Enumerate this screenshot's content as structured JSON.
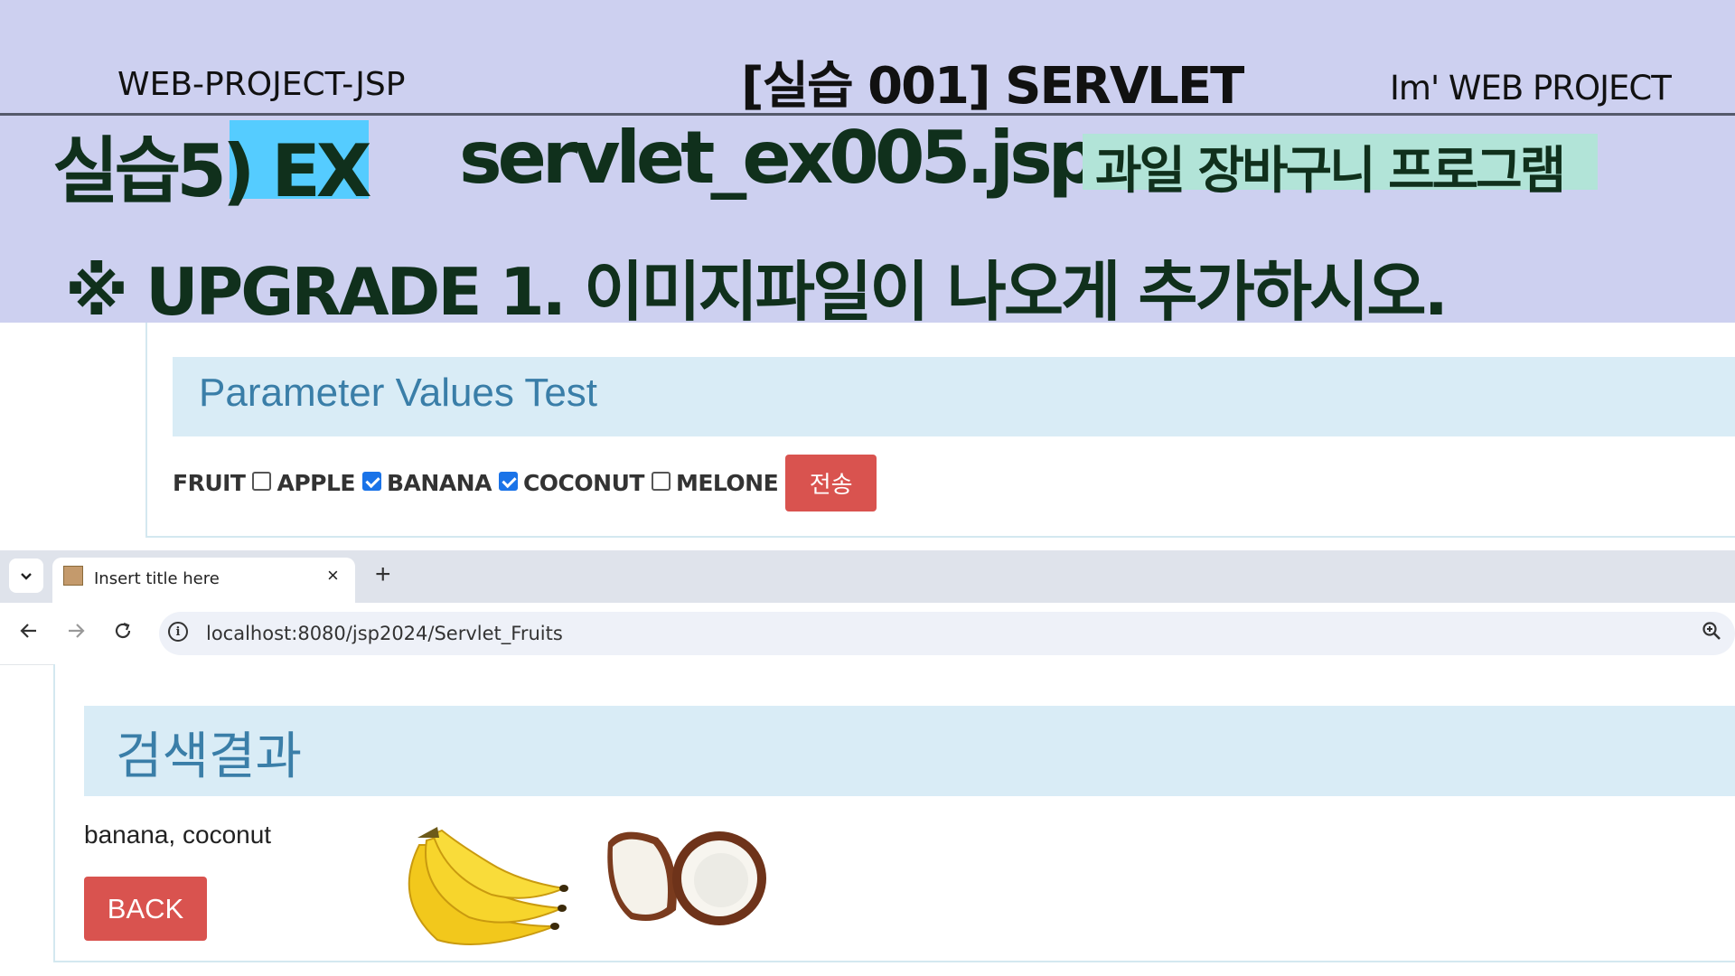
{
  "slide": {
    "header_left": "WEB-PROJECT-JSP",
    "header_center": "[실습 001]  SERVLET",
    "header_right": "Im'  WEB PROJECT",
    "title_prefix": "실습5) EX",
    "title_file": "servlet_ex005.jsp",
    "title_desc": "과일 장바구니 프로그램",
    "upgrade_note": "※ UPGRADE  1. 이미지파일이 나오게 추가하시오."
  },
  "form_page": {
    "heading": "Parameter Values Test",
    "fruit_label": "FRUIT",
    "options": [
      {
        "label": "APPLE",
        "checked": false
      },
      {
        "label": "BANANA",
        "checked": true
      },
      {
        "label": "COCONUT",
        "checked": true
      },
      {
        "label": "MELONE",
        "checked": false
      }
    ],
    "submit_label": "전송"
  },
  "browser": {
    "tab_title": "Insert title here",
    "close_glyph": "×",
    "new_tab_glyph": "+",
    "url": "localhost:8080/jsp2024/Servlet_Fruits",
    "info_glyph": "i"
  },
  "result_page": {
    "heading": "검색결과",
    "result_text": "banana, coconut",
    "back_label": "BACK",
    "images": [
      "banana-image",
      "coconut-image"
    ]
  }
}
